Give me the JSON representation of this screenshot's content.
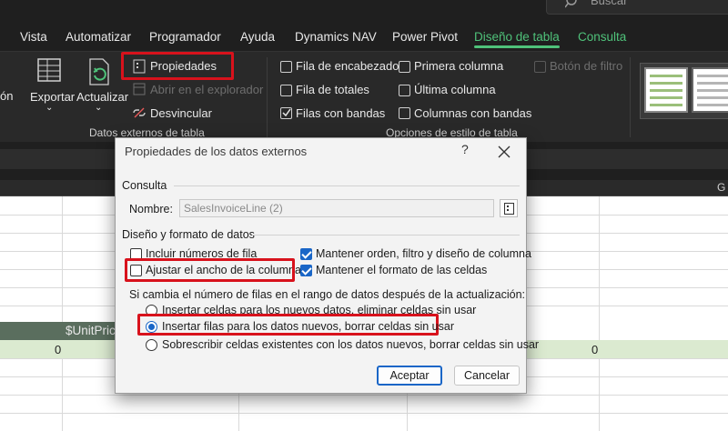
{
  "search": {
    "placeholder": "Buscar"
  },
  "tabs": [
    {
      "label": "Vista"
    },
    {
      "label": "Automatizar"
    },
    {
      "label": "Programador"
    },
    {
      "label": "Ayuda"
    },
    {
      "label": "Dynamics NAV"
    },
    {
      "label": "Power Pivot"
    },
    {
      "label": "Diseño de tabla"
    },
    {
      "label": "Consulta"
    }
  ],
  "ribbon": {
    "left_partial": "ón",
    "exportar": "Exportar",
    "actualizar": "Actualizar",
    "propiedades": "Propiedades",
    "abrir_explorador": "Abrir en el explorador",
    "desvincular": "Desvincular",
    "group_datos": "Datos externos de tabla",
    "fila_encabezado": "Fila de encabezado",
    "fila_totales": "Fila de totales",
    "filas_bandas": "Filas con bandas",
    "primera_columna": "Primera columna",
    "ultima_columna": "Última columna",
    "columnas_bandas": "Columnas con bandas",
    "boton_filtro": "Botón de filtro",
    "group_opciones": "Opciones de estilo de tabla"
  },
  "sheet": {
    "col_g": "G",
    "header_text": "$UnitPric",
    "value_left": "0",
    "value_right": "0"
  },
  "dialog": {
    "title": "Propiedades de los datos externos",
    "help": "?",
    "section_consulta": "Consulta",
    "nombre_label": "Nombre:",
    "nombre_value": "SalesInvoiceLine (2)",
    "section_diseno": "Diseño y formato de datos",
    "incluir_numeros": "Incluir números de fila",
    "ajustar_ancho": "Ajustar el ancho de la columna",
    "mantener_orden": "Mantener orden, filtro y diseño de columna",
    "mantener_formato": "Mantener el formato de las celdas",
    "si_cambia": "Si cambia el número de filas en el rango de datos después de la actualización:",
    "opcion1": "Insertar celdas para los nuevos datos, eliminar celdas sin usar",
    "opcion2": "Insertar filas para los datos nuevos, borrar celdas sin usar",
    "opcion3": "Sobrescribir celdas existentes con los datos nuevos, borrar celdas sin usar",
    "aceptar": "Aceptar",
    "cancelar": "Cancelar"
  },
  "colors": {
    "accent_green": "#4fc27a",
    "highlight_red": "#d8121c",
    "checkbox_blue": "#1a66c7"
  }
}
